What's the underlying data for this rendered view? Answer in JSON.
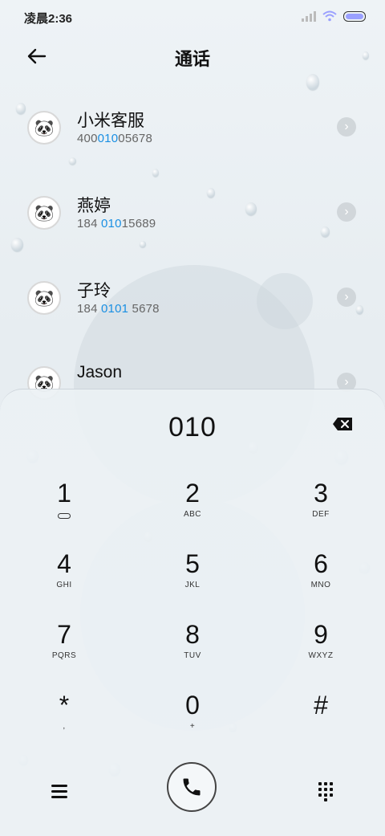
{
  "status": {
    "time": "凌晨2:36"
  },
  "header": {
    "title": "通话",
    "back_icon": "arrow-left-icon"
  },
  "results": [
    {
      "name": "小米客服",
      "number_pre": "400",
      "number_hl": "010",
      "number_post": "05678"
    },
    {
      "name": "燕婷",
      "number_pre": "184 ",
      "number_hl": "010",
      "number_post": "15689"
    },
    {
      "name": "子玲",
      "number_pre": "184 ",
      "number_hl": "0101",
      "number_post": " 5678"
    },
    {
      "name": "Jason",
      "number_pre": "",
      "number_hl": "",
      "number_post": ""
    }
  ],
  "dialpad": {
    "typed": "010",
    "keys": [
      {
        "digit": "1",
        "letters": ""
      },
      {
        "digit": "2",
        "letters": "ABC"
      },
      {
        "digit": "3",
        "letters": "DEF"
      },
      {
        "digit": "4",
        "letters": "GHI"
      },
      {
        "digit": "5",
        "letters": "JKL"
      },
      {
        "digit": "6",
        "letters": "MNO"
      },
      {
        "digit": "7",
        "letters": "PQRS"
      },
      {
        "digit": "8",
        "letters": "TUV"
      },
      {
        "digit": "9",
        "letters": "WXYZ"
      },
      {
        "digit": "*",
        "letters": ","
      },
      {
        "digit": "0",
        "letters": "+"
      },
      {
        "digit": "#",
        "letters": ""
      }
    ]
  },
  "colors": {
    "highlight": "#1a8fe3"
  }
}
